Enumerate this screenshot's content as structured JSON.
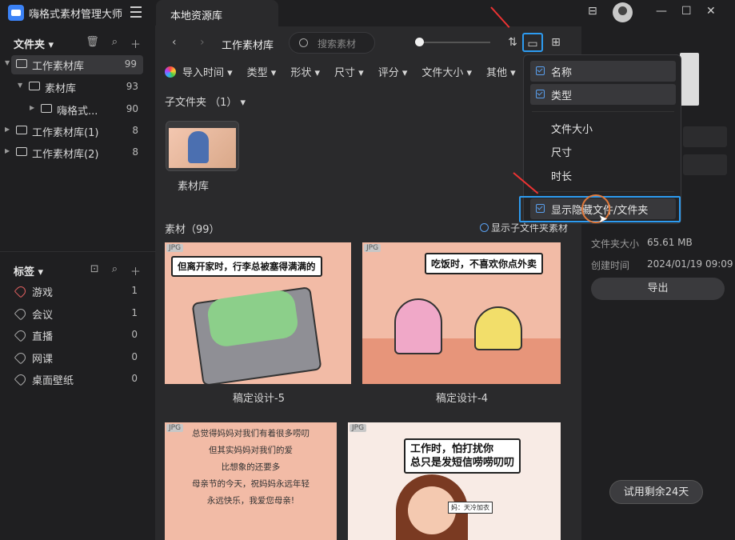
{
  "app": {
    "title": "嗨格式素材管理大师"
  },
  "tabs": [
    {
      "label": "本地资源库"
    }
  ],
  "sidebar": {
    "folders_title": "文件夹 ▾",
    "tree": [
      {
        "label": "工作素材库",
        "count": "99"
      },
      {
        "label": "素材库",
        "count": "93"
      },
      {
        "label": "嗨格式...",
        "count": "90"
      },
      {
        "label": "工作素材库(1)",
        "count": "8"
      },
      {
        "label": "工作素材库(2)",
        "count": "8"
      }
    ],
    "tags_title": "标签 ▾",
    "tags": [
      {
        "label": "游戏",
        "count": "1",
        "color": "#e06060"
      },
      {
        "label": "会议",
        "count": "1",
        "color": "#aaaaaa"
      },
      {
        "label": "直播",
        "count": "0",
        "color": "#aaaaaa"
      },
      {
        "label": "网课",
        "count": "0",
        "color": "#aaaaaa"
      },
      {
        "label": "桌面壁纸",
        "count": "0",
        "color": "#aaaaaa"
      }
    ]
  },
  "toolbar": {
    "breadcrumb": "工作素材库",
    "search_placeholder": "搜索素材"
  },
  "filters": [
    "导入时间 ▾",
    "类型 ▾",
    "形状 ▾",
    "尺寸 ▾",
    "评分 ▾",
    "文件大小 ▾",
    "其他 ▾"
  ],
  "subfolders": {
    "header": "子文件夹 （1） ▾",
    "items": [
      {
        "name": "素材库"
      }
    ]
  },
  "materials": {
    "header": "素材（99）",
    "show_sub": "显示子文件夹素材",
    "items": [
      {
        "badge": "JPG",
        "name": "稿定设计-5",
        "caption": "但离开家时，行李总被塞得满满的"
      },
      {
        "badge": "JPG",
        "name": "稿定设计-4",
        "caption": "吃饭时，不喜欢你点外卖"
      },
      {
        "badge": "JPG",
        "lines": [
          "总觉得妈妈对我们有着很多唠叨",
          "但其实妈妈对我们的爱",
          "比想象的还要多",
          "母亲节的今天，祝妈妈永远年轻",
          "永远快乐，我爱您母亲!"
        ]
      },
      {
        "badge": "JPG",
        "caption_line1": "工作时，怕打扰你",
        "caption_line2": "总只是发短信唠唠叨叨",
        "sign": "妈：天冷加衣"
      }
    ]
  },
  "dropdown": {
    "items": [
      {
        "label": "名称",
        "checked": true
      },
      {
        "label": "类型",
        "checked": true
      },
      {
        "label": "文件大小",
        "checked": false
      },
      {
        "label": "尺寸",
        "checked": false
      },
      {
        "label": "时长",
        "checked": false
      },
      {
        "label": "显示隐藏文件/文件夹",
        "checked": true
      }
    ]
  },
  "details": {
    "size_label": "文件夹大小",
    "size_value": "65.61 MB",
    "created_label": "创建时间",
    "created_value": "2024/01/19 09:09",
    "export_label": "导出"
  },
  "trial": "试用剩余24天",
  "colors": {
    "accent": "#2d9bf0",
    "annotation": "#e33333",
    "cursor_ring": "#e0783a"
  }
}
